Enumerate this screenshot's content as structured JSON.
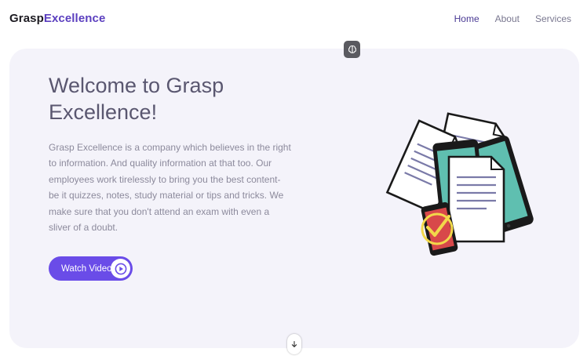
{
  "brand": {
    "part1": "Grasp",
    "part2": "Excellence",
    "accent_color": "#5b3fbf"
  },
  "nav": {
    "links": [
      {
        "label": "Home",
        "active": true
      },
      {
        "label": "About",
        "active": false
      },
      {
        "label": "Services",
        "active": false
      }
    ]
  },
  "hero": {
    "title": "Welcome to Grasp Excellence!",
    "description": "Grasp Excellence is a company which believes in the right to information. And quality information at that too. Our employees work tirelessly to bring you the best content- be it quizzes, notes, study material or tips and tricks. We make sure that you don't attend an exam with even a sliver of a doubt.",
    "cta_label": "Watch Video",
    "cta_color": "#6a4ce8",
    "cta_icon": "play-icon",
    "illustration": "documents-devices-illustration"
  },
  "icons": {
    "top_chip": "brain-icon",
    "scroll": "arrow-down-icon"
  },
  "colors": {
    "hero_bg": "#f4f3fa",
    "title": "#5a5770",
    "text": "#8c8a9c"
  }
}
